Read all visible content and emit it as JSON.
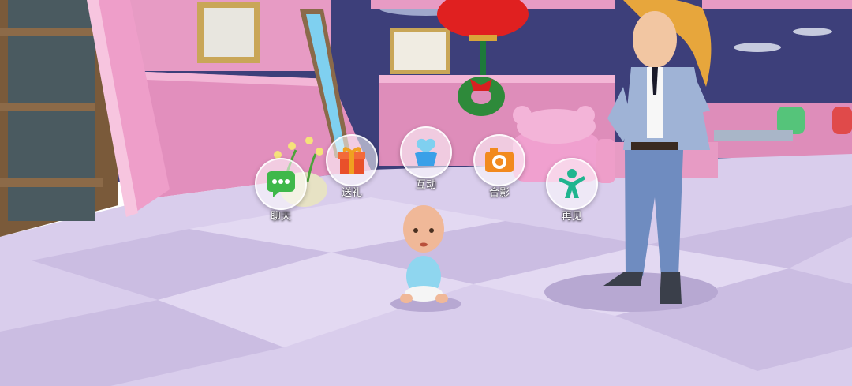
{
  "actions": [
    {
      "id": "chat",
      "label": "聊天",
      "icon": "chat-bubble-icon",
      "color": "#3fb84a"
    },
    {
      "id": "gift",
      "label": "送礼",
      "icon": "gift-box-icon",
      "color": "#f0a020"
    },
    {
      "id": "interact",
      "label": "互动",
      "icon": "hand-heart-icon",
      "color": "#3aa0e8"
    },
    {
      "id": "photo",
      "label": "合影",
      "icon": "camera-icon",
      "color": "#f28a1e"
    },
    {
      "id": "bye",
      "label": "再见",
      "icon": "waving-person-icon",
      "color": "#1fb58f"
    }
  ],
  "scene": {
    "wall_color": "#e79bc4",
    "sky_color": "#3d3f7a",
    "floor_color": "#d9cdec"
  }
}
